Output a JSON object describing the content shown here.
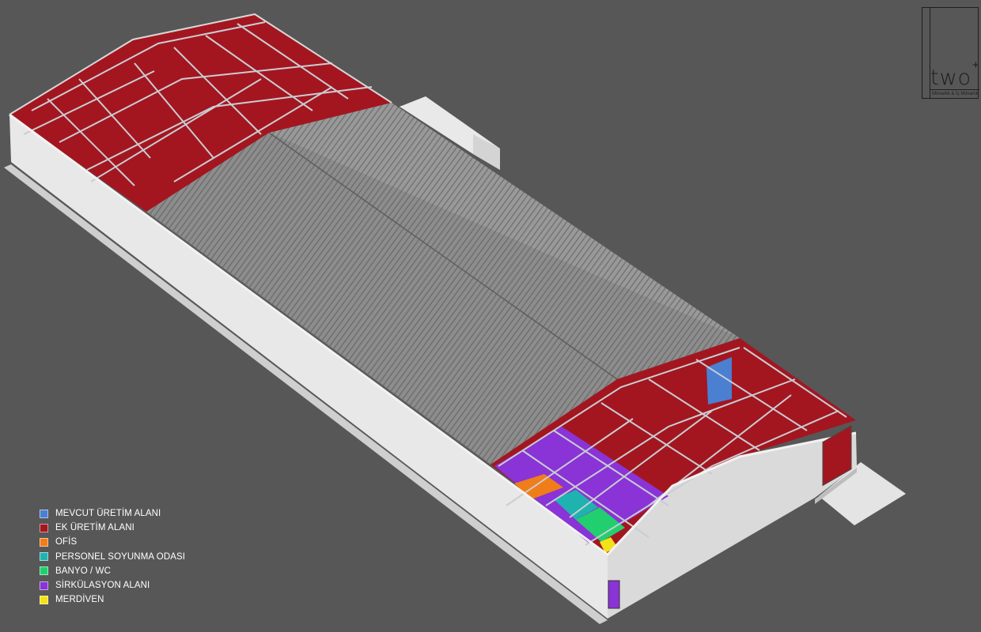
{
  "legend": {
    "items": [
      {
        "label": "MEVCUT ÜRETİM ALANI",
        "color": "#4a7fd1"
      },
      {
        "label": "EK ÜRETİM ALANI",
        "color": "#a31620"
      },
      {
        "label": "OFİS",
        "color": "#f07d1a"
      },
      {
        "label": "PERSONEL SOYUNMA ODASI",
        "color": "#1fb3b0"
      },
      {
        "label": "BANYO / WC",
        "color": "#22cf6e"
      },
      {
        "label": "SİRKÜLASYON ALANI",
        "color": "#8a33d6"
      },
      {
        "label": "MERDİVEN",
        "color": "#f3e21a"
      }
    ]
  },
  "logo": {
    "word": "two",
    "mark": "+",
    "subtitle": "Mimarlık & İç Mimarlık"
  },
  "colors": {
    "background": "#575757",
    "roof_panel": "#8c8c8c",
    "wall": "#e6e6e6",
    "steel_frame": "#c9cdd2"
  }
}
